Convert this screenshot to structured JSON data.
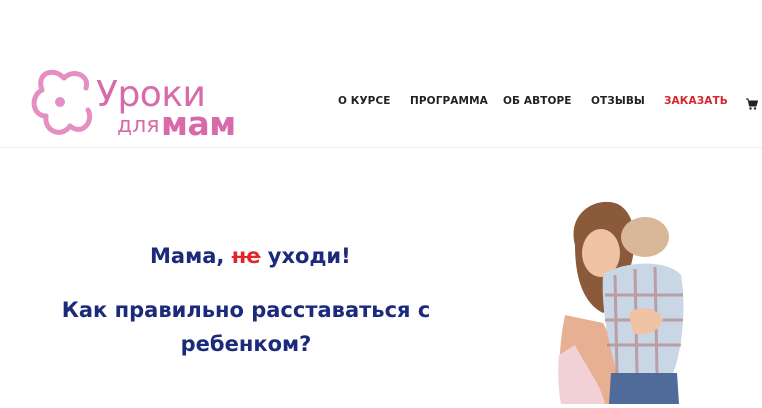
{
  "logo": {
    "line1": "Уроки",
    "line2_small": "для",
    "line2_big": "мам"
  },
  "nav": {
    "items": [
      {
        "label": "О КУРСЕ"
      },
      {
        "label": "ПРОГРАММА"
      },
      {
        "label": "ОБ АВТОРЕ"
      },
      {
        "label": "ОТЗЫВЫ"
      },
      {
        "label": "ЗАКАЗАТЬ",
        "accent": true
      }
    ],
    "cart_icon": "cart-icon"
  },
  "hero": {
    "title_before": "Мама,",
    "title_struck": "не",
    "title_after": "уходи!",
    "subtitle": "Как правильно расставаться с ребенком?"
  },
  "colors": {
    "brand_pink": "#d96aaa",
    "accent_red": "#d6262b",
    "heading_navy": "#1b2a7a"
  }
}
